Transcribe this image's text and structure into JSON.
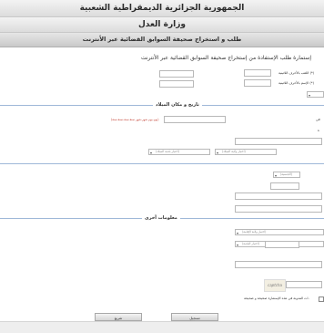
{
  "header": {
    "republic": "الجمهورية الجزائرية الديمقراطية الشعبية",
    "ministry": "وزارة العدل",
    "service": "طلب و استخراج صحيفة السوابق القضائية عبر الأنترنت"
  },
  "form": {
    "title": "إستمارة طلب الإستفادة من إستخراج صحيفة السوابق القضائية عبر الأنترنت",
    "labels": {
      "last_name_latin": "اللقب بالأحرف اللاتينية (*)",
      "first_name_latin": "الإسم بالأحرف اللاتينية (*)",
      "birth_prefix": "في",
      "birth_suffix": "ة"
    },
    "date_hint": "(يوم-يوم شهر-شهر سنة-سنة-سنة-سنة)",
    "selects": {
      "birth_wilaya": "(اختيار ولاية الميلاد)",
      "birth_commune": "(اختيار بلدية الميلاد)",
      "nationality": "(الجنسية)",
      "residence_wilaya": "(اختيار ولاية الإقامة)",
      "residence_commune": "(اختيار البلدية)"
    },
    "sections": {
      "birth": "تاريخ و مكان الميلاد",
      "other": "معلومات أخرى"
    },
    "confirm_text": "ات المدونة في هذه الإستمارة صحيحة و صحيحة.",
    "captcha_text": "captcha"
  },
  "buttons": {
    "send": "تسجيل",
    "reset": "تفريغ"
  }
}
